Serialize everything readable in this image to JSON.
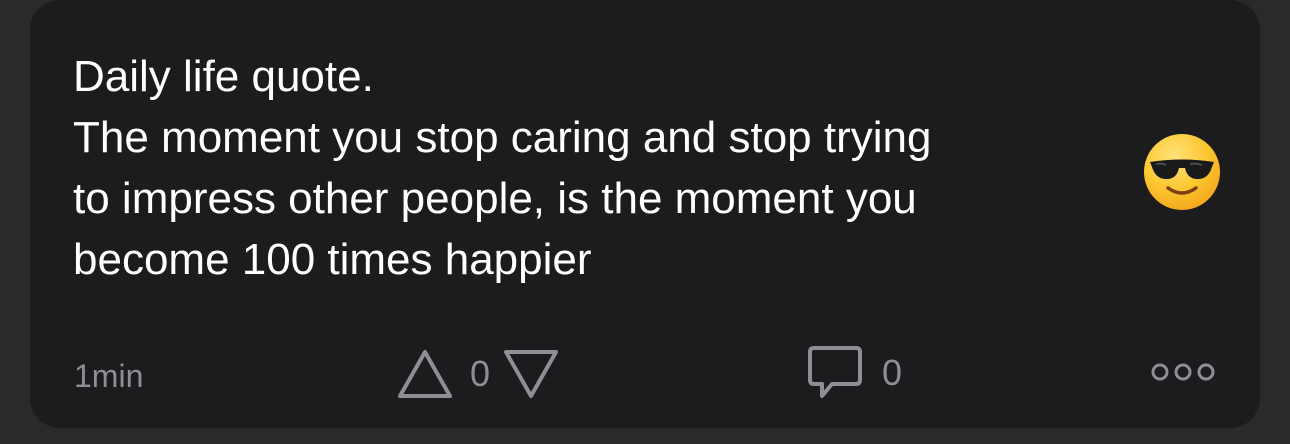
{
  "post": {
    "text": "Daily life quote.\nThe moment you stop caring and stop trying\nto impress other people, is the moment you\nbecome 100 times happier",
    "emoji": "smiling-face-with-sunglasses"
  },
  "footer": {
    "timestamp": "1min",
    "vote_count": "0",
    "comment_count": "0"
  },
  "icons": {
    "upvote": "triangle-up-icon",
    "downvote": "triangle-down-icon",
    "comment": "speech-bubble-icon",
    "more": "ellipsis-icon"
  },
  "colors": {
    "background": "#2a2a2c",
    "card": "#1c1c1e",
    "text": "#ffffff",
    "muted": "#8e8e93"
  }
}
